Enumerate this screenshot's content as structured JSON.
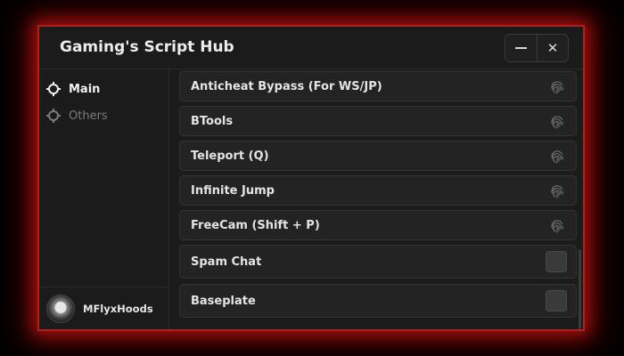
{
  "window": {
    "title": "Gaming's Script Hub",
    "minimize_icon": "minimize-icon",
    "close_icon": "close-icon",
    "glow_color": "#b0201c",
    "background_color": "#1b1b1b"
  },
  "sidebar": {
    "items": [
      {
        "label": "Main",
        "icon": "crosshair-icon",
        "active": true
      },
      {
        "label": "Others",
        "icon": "crosshair-icon",
        "active": false
      }
    ]
  },
  "user": {
    "name": "MFlyxHoods",
    "avatar": "avatar-image"
  },
  "scripts": [
    {
      "label": "Anticheat Bypass (For WS/JP)",
      "control": "fingerprint-icon"
    },
    {
      "label": "BTools",
      "control": "fingerprint-icon"
    },
    {
      "label": "Teleport (Q)",
      "control": "fingerprint-icon"
    },
    {
      "label": "Infinite Jump",
      "control": "fingerprint-icon"
    },
    {
      "label": "FreeCam (Shift + P)",
      "control": "fingerprint-icon"
    },
    {
      "label": "Spam Chat",
      "control": "toggle",
      "enabled": false
    },
    {
      "label": "Baseplate",
      "control": "toggle",
      "enabled": false
    }
  ]
}
